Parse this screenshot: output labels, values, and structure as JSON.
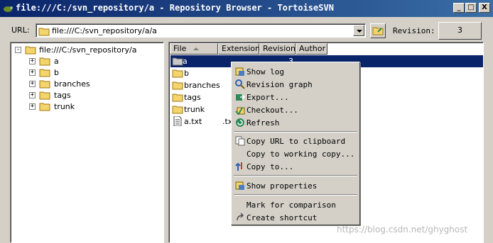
{
  "window": {
    "title": "file:///C:/svn_repository/a - Repository Browser - TortoiseSVN",
    "min_label": "_",
    "max_label": "□",
    "close_label": "X"
  },
  "urlbar": {
    "label": "URL:",
    "value": "file:///C:/svn_repository/a/a",
    "revision_label": "Revision:",
    "revision_value": "3"
  },
  "tree": {
    "root": "file:///C:/svn_repository/a",
    "root_toggle": "-",
    "items": [
      {
        "label": "a",
        "toggle": "+"
      },
      {
        "label": "b",
        "toggle": "+"
      },
      {
        "label": "branches",
        "toggle": "+"
      },
      {
        "label": "tags",
        "toggle": "+"
      },
      {
        "label": "trunk",
        "toggle": "+"
      }
    ]
  },
  "list": {
    "columns": [
      "File",
      "Extension",
      "Revision",
      "Author"
    ],
    "rows": [
      {
        "name": "a",
        "extension": "",
        "revision": "3",
        "type": "folder",
        "selected": true
      },
      {
        "name": "b",
        "extension": "",
        "revision": "",
        "type": "folder"
      },
      {
        "name": "branches",
        "extension": "",
        "revision": "",
        "type": "folder"
      },
      {
        "name": "tags",
        "extension": "",
        "revision": "",
        "type": "folder"
      },
      {
        "name": "trunk",
        "extension": "",
        "revision": "",
        "type": "folder"
      },
      {
        "name": "a.txt",
        "extension": ".tx",
        "revision": "",
        "type": "file"
      }
    ]
  },
  "context_menu": {
    "items": [
      {
        "label": "Show log",
        "icon": "show-log-icon"
      },
      {
        "label": "Revision graph",
        "icon": "revision-graph-icon"
      },
      {
        "label": "Export...",
        "icon": "export-icon"
      },
      {
        "label": "Checkout...",
        "icon": "checkout-icon"
      },
      {
        "label": "Refresh",
        "icon": "refresh-icon"
      },
      {
        "label": "Copy URL to clipboard",
        "icon": "copy-url-icon"
      },
      {
        "label": "Copy to working copy...",
        "icon": ""
      },
      {
        "label": "Copy to...",
        "icon": "copy-to-icon"
      },
      {
        "label": "Show properties",
        "icon": "properties-icon"
      },
      {
        "label": "Mark for comparison",
        "icon": ""
      },
      {
        "label": "Create shortcut",
        "icon": "shortcut-icon"
      }
    ]
  },
  "watermark": "https://blog.csdn.net/ghyghost",
  "colors": {
    "titlebar_start": "#0a246a",
    "titlebar_end": "#3a6ea5",
    "selection": "#0a246a",
    "face": "#d4d0c8",
    "folder": "#f4d46c"
  }
}
